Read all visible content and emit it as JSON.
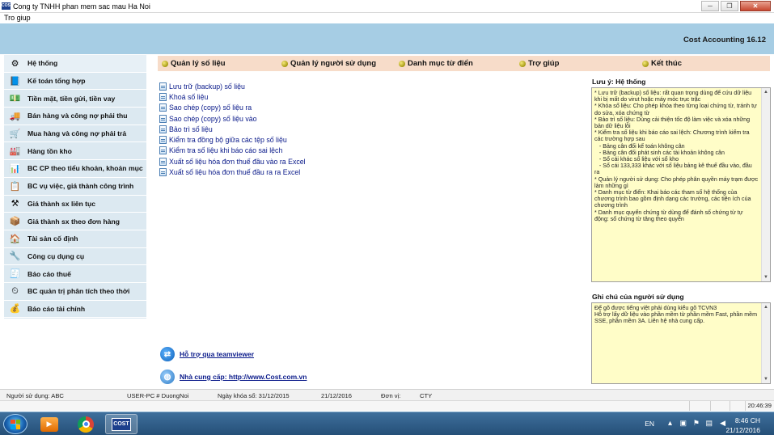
{
  "window": {
    "icon_text": "COST",
    "title": "Cong ty TNHH phan mem sac mau Ha Noi",
    "min_symbol": "─",
    "max_symbol": "❐",
    "close_symbol": "✕"
  },
  "menubar": {
    "help": "Tro giup"
  },
  "banner": {
    "app_name": "Cost Accounting 16.12"
  },
  "sidebar": {
    "items": [
      {
        "label": "Hệ thống",
        "icon": "gear-monitor-icon",
        "glyph": "⚙"
      },
      {
        "label": "Kế toán tổng hợp",
        "icon": "ledger-icon",
        "glyph": "📘"
      },
      {
        "label": "Tiền mặt, tiền gửi, tiền vay",
        "icon": "cash-icon",
        "glyph": "💵"
      },
      {
        "label": "Bán hàng và công nợ phải thu",
        "icon": "truck-icon",
        "glyph": "🚚"
      },
      {
        "label": "Mua hàng và công nợ phải trả",
        "icon": "cart-icon",
        "glyph": "🛒"
      },
      {
        "label": "Hàng tồn kho",
        "icon": "warehouse-icon",
        "glyph": "🏭"
      },
      {
        "label": "BC CP theo tiểu khoản, khoản mục",
        "icon": "report-icon",
        "glyph": "📊"
      },
      {
        "label": "BC vụ việc, giá thành công trình",
        "icon": "checklist-icon",
        "glyph": "📋"
      },
      {
        "label": "Giá thành sx liên tục",
        "icon": "production-icon",
        "glyph": "⚒"
      },
      {
        "label": "Giá thành sx theo đơn hàng",
        "icon": "order-icon",
        "glyph": "📦"
      },
      {
        "label": "Tài sản cố định",
        "icon": "house-icon",
        "glyph": "🏠"
      },
      {
        "label": "Công cụ dụng cụ",
        "icon": "tools-icon",
        "glyph": "🔧"
      },
      {
        "label": "Báo cáo thuế",
        "icon": "tax-icon",
        "glyph": "🧾"
      },
      {
        "label": "BC quản trị phân tích theo thời",
        "icon": "clock-chart-icon",
        "glyph": "⏲"
      },
      {
        "label": "Báo cáo tài chính",
        "icon": "finance-icon",
        "glyph": "💰"
      }
    ]
  },
  "topnav": {
    "items": [
      {
        "label": "Quản lý số liệu"
      },
      {
        "label": "Quản lý người sử dụng"
      },
      {
        "label": "Danh mục từ điển"
      },
      {
        "label": "Trợ giúp"
      },
      {
        "label": "Kết thúc"
      }
    ]
  },
  "functions": [
    "Lưu trữ (backup) số liệu",
    "Khoá số liệu",
    "Sao chép (copy) số liệu ra",
    "Sao chép (copy) số liệu vào",
    "Bảo trì số liệu",
    "Kiểm tra đồng bộ giữa các tệp số liệu",
    "Kiểm tra số liệu khi báo cáo sai lệch",
    "Xuất số liệu hóa đơn thuế đầu vào ra Excel",
    "Xuất số liệu hóa đơn thuế đầu ra ra Excel"
  ],
  "support": {
    "teamviewer": "Hỗ trợ qua teamviewer",
    "provider": "Nhà cung cấp: http://www.Cost.com.vn"
  },
  "notes": {
    "title": "Lưu ý: Hệ thống",
    "text": "* Lưu trữ (backup) số liệu: rất quan trọng dùng để cứu dữ liệu khi bị mất do virut hoặc máy móc trục trặc\n* Khóa số liệu: Cho phép khóa theo từng loại chứng từ, tránh tự do sửa, xóa chứng từ\n* Bảo trì số liệu: Dùng cải thiện tốc độ làm việc và xóa những bản dữ liệu lỗi\n* Kiểm tra số liệu khi báo cáo sai lệch: Chương trình kiểm tra các trường hợp sau\n   - Bảng cân đối kế toán không cân\n   - Bảng cân đối phát sinh các tài khoản không cân\n   - Sổ cái khác số liệu với sổ kho\n   - Sổ cái 133,333 khác với số liệu bảng kê thuế đầu vào, đầu ra\n* Quản lý người sử dụng: Cho phép phân quyền máy trạm được làm những gì\n* Danh mục từ điển: Khai báo các tham số hệ thống của chương trình bao gồm định dạng các trường, các tiện ích của chương trình\n* Danh mục quyển chứng từ dùng để đánh số chứng từ tự động: số chứng từ tăng theo quyển"
  },
  "user_notes": {
    "title": "Ghi chú của người sử dụng",
    "text": "Để gõ được tiếng việt phải dùng kiểu gõ TCVN3\nHỗ trợ lấy dữ liệu vào phần mềm từ phần mềm Fast, phần mềm SSE, phần mềm 3A. Liên hệ nhà cung cấp."
  },
  "statusbar": {
    "user": "Người sử dụng: ABC",
    "machine": "USER-PC # DuongNoi",
    "lock_date": "Ngày khóa sổ: 31/12/2015",
    "date": "21/12/2016",
    "unit_label": "Đơn vị:",
    "unit": "CTY",
    "clock": "20:46:39"
  },
  "taskbar": {
    "cost_label": "COST",
    "lang": "EN",
    "time": "8:46 CH",
    "date": "21/12/2016"
  },
  "colors": {
    "banner": "#a6cde4",
    "sidebar": "#dce9f1",
    "topnav": "#f7dcc9",
    "notes_bg": "#fffdc8",
    "link": "#0a1a8a"
  }
}
